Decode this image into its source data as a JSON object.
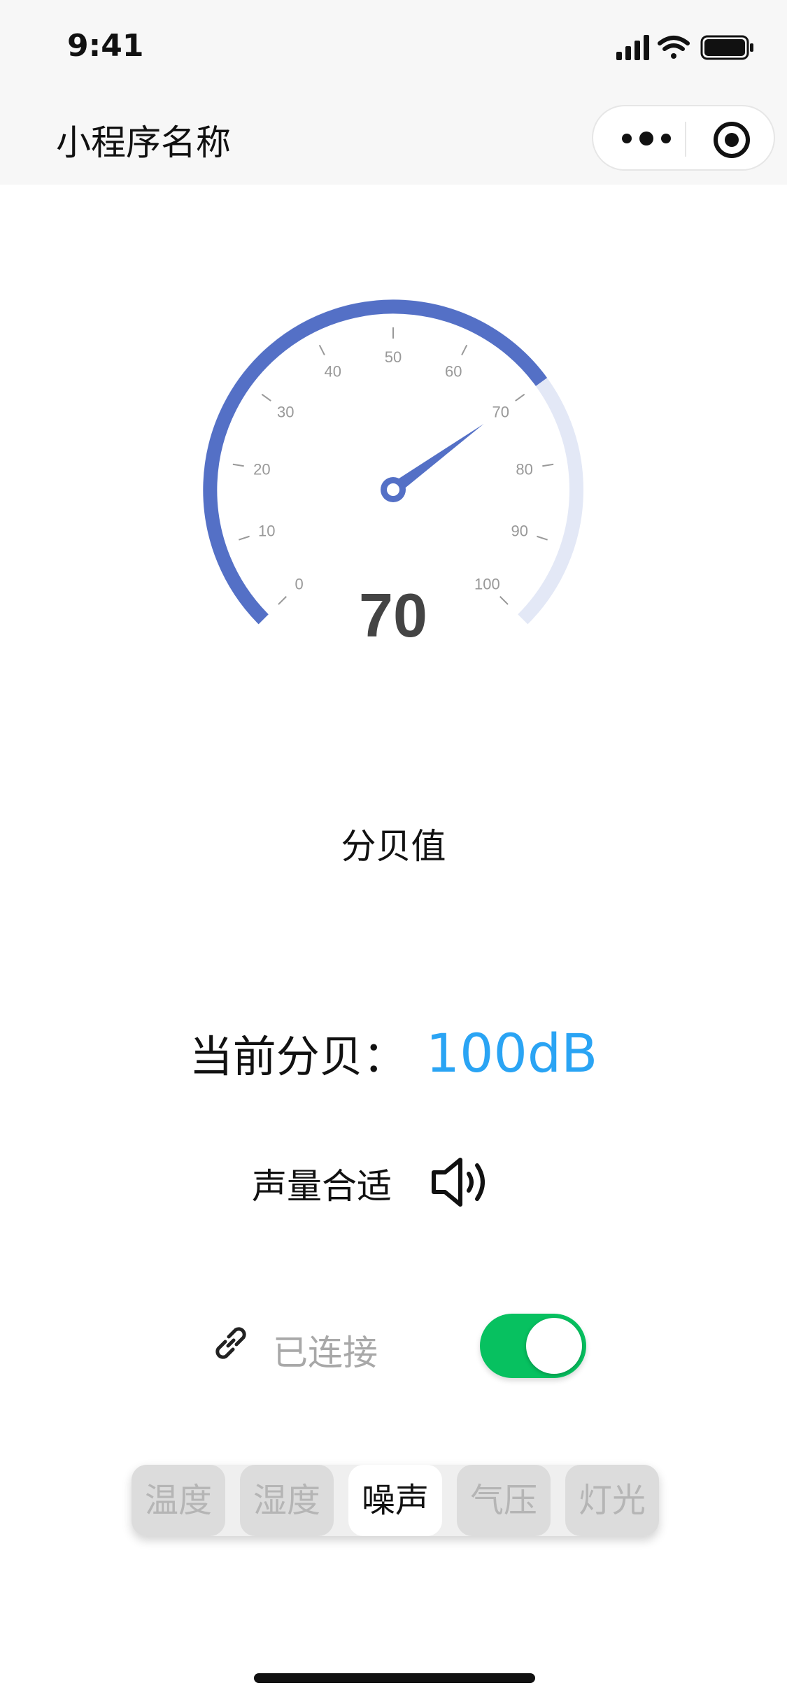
{
  "status_bar": {
    "time": "9:41",
    "icons": [
      "signal-icon",
      "wifi-icon",
      "battery-icon"
    ]
  },
  "nav": {
    "title": "小程序名称",
    "more_icon": "more-dots-icon",
    "close_icon": "target-icon"
  },
  "gauge": {
    "value_display": "70",
    "value": 70,
    "min": 0,
    "max": 100,
    "tick_labels": [
      "0",
      "10",
      "20",
      "30",
      "40",
      "50",
      "60",
      "70",
      "80",
      "90",
      "100"
    ],
    "colors": {
      "active": "#5470c6",
      "inactive": "#e3e8f6",
      "tick": "#999999",
      "value_text": "#444444"
    }
  },
  "label": "分贝值",
  "current": {
    "label": "当前分贝：",
    "value": "100dB",
    "value_color": "#2aa4f4"
  },
  "volume": {
    "text": "声量合适",
    "icon": "speaker-icon"
  },
  "connection": {
    "icon": "link-icon",
    "text": "已连接",
    "toggle_on": true,
    "toggle_color": "#07c160"
  },
  "tabs": {
    "items": [
      "温度",
      "湿度",
      "噪声",
      "气压",
      "灯光"
    ],
    "active": "噪声"
  }
}
